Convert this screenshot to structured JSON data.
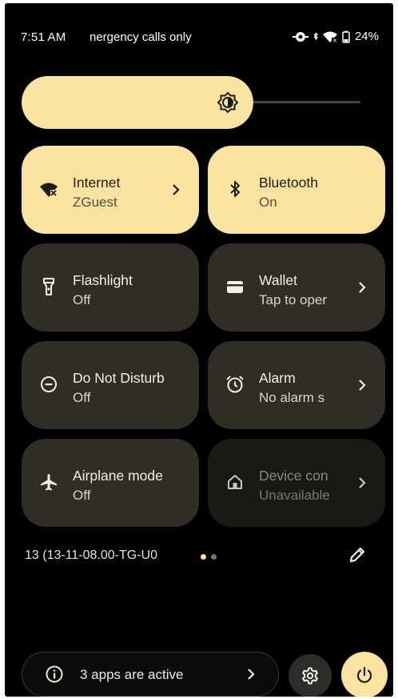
{
  "status_bar": {
    "time": "7:51 AM",
    "carrier_text": "nergency calls only",
    "battery_percent": "24%",
    "icons": [
      "eye-icon",
      "bluetooth-small-icon",
      "wifi-icon",
      "battery-icon"
    ]
  },
  "brightness": {
    "level": 0.68,
    "icon": "brightness-icon"
  },
  "tiles": [
    {
      "label": "Internet",
      "sub": "ZGuest",
      "icon": "wifi-icon",
      "state": "on",
      "chevron": true
    },
    {
      "label": "Bluetooth",
      "sub": "On",
      "icon": "bluetooth-icon",
      "state": "on",
      "chevron": false
    },
    {
      "label": "Flashlight",
      "sub": "Off",
      "icon": "flashlight-icon",
      "state": "off",
      "chevron": false
    },
    {
      "label": "Wallet",
      "sub": "Tap to oper",
      "icon": "wallet-icon",
      "state": "off",
      "chevron": true
    },
    {
      "label": "Do Not Disturb",
      "sub": "Off",
      "icon": "do-not-disturb-icon",
      "state": "off",
      "chevron": false
    },
    {
      "label": "Alarm",
      "sub": "No alarm s",
      "icon": "alarm-icon",
      "state": "off",
      "chevron": true
    },
    {
      "label": "Airplane mode",
      "sub": "Off",
      "icon": "airplane-icon",
      "state": "off",
      "chevron": false
    },
    {
      "label": "Device con",
      "sub": "Unavailable",
      "icon": "home-icon",
      "state": "unavailable",
      "chevron": true
    }
  ],
  "footer": {
    "build_text": "13 (13-11-08.00-TG-U0",
    "page_dots": 2,
    "active_page": 0,
    "edit_icon": "pencil-icon"
  },
  "bottom_bar": {
    "active_apps_text": "3 apps are active",
    "settings_icon": "gear-icon",
    "power_icon": "power-icon"
  },
  "colors": {
    "accent": "#fae2a0",
    "tile_off": "#302d26",
    "tile_unavailable": "#1a1916",
    "background": "#000000"
  }
}
